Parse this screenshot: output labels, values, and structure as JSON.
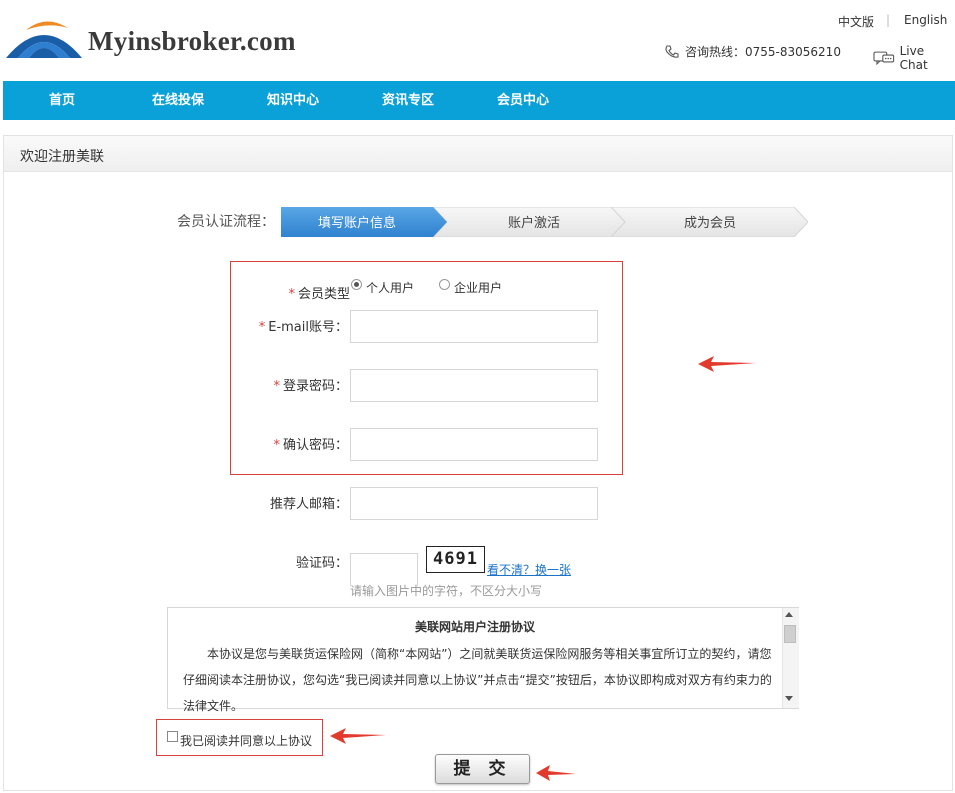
{
  "header": {
    "brand": "Myinsbroker.com",
    "lang_cn": "中文版",
    "lang_sep": "|",
    "lang_en": "English",
    "hotline": "咨询热线：0755-83056210",
    "livechat": "Live Chat"
  },
  "nav": {
    "items": [
      "首页",
      "在线投保",
      "知识中心",
      "资讯专区",
      "会员中心"
    ]
  },
  "main": {
    "title": "欢迎注册美联"
  },
  "steps": {
    "label": "会员认证流程：",
    "items": [
      "填写账户信息",
      "账户激活",
      "成为会员"
    ]
  },
  "form": {
    "member_type_label": "会员类型",
    "member_type_options": [
      "个人用户",
      "企业用户"
    ],
    "email_label": "E-mail账号：",
    "password_label": "登录密码：",
    "confirm_label": "确认密码：",
    "referrer_label": "推荐人邮箱：",
    "captcha_label": "验证码：",
    "captcha_text": "4691",
    "refresh_link": "看不清？换一张",
    "captcha_hint": "请输入图片中的字符，不区分大小写",
    "required_mark": "*"
  },
  "agreement": {
    "title": "美联网站用户注册协议",
    "body": "本协议是您与美联货运保险网（简称“本网站”）之间就美联货运保险网服务等相关事宜所订立的契约，请您仔细阅读本注册协议，您勾选“我已阅读并同意以上协议”并点击“提交”按钮后，本协议即构成对双方有约束力的法律文件。",
    "checkbox_label": "我已阅读并同意以上协议"
  },
  "submit_label": "提 交",
  "colors": {
    "nav_bg": "#0aa0d8",
    "step_active": "#3c8fd6",
    "annotation_red": "#d9413d",
    "link": "#1a73c9"
  }
}
